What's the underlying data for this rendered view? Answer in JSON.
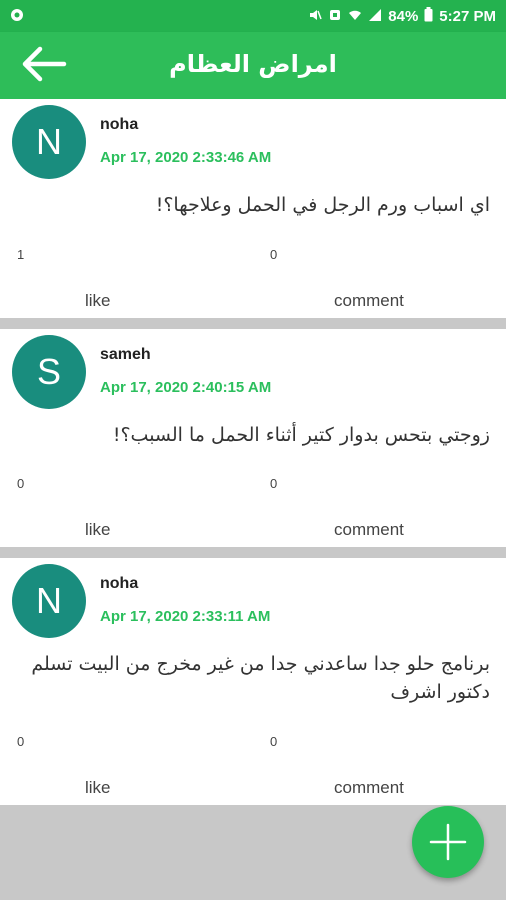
{
  "status_bar": {
    "battery": "84%",
    "time": "5:27 PM"
  },
  "app_bar": {
    "title": "امراض العظام",
    "back_icon": "arrow-left-icon"
  },
  "posts": [
    {
      "avatar_letter": "N",
      "username": "noha",
      "timestamp": "Apr 17, 2020 2:33:46 AM",
      "text": "اي اسباب ورم الرجل في الحمل وعلاجها؟!",
      "like_count": "1",
      "comment_count": "0",
      "like_label": "like",
      "comment_label": "comment"
    },
    {
      "avatar_letter": "S",
      "username": "sameh",
      "timestamp": "Apr 17, 2020 2:40:15 AM",
      "text": "زوجتي بتحس بدوار كتير أثناء الحمل ما السبب؟!",
      "like_count": "0",
      "comment_count": "0",
      "like_label": "like",
      "comment_label": "comment"
    },
    {
      "avatar_letter": "N",
      "username": "noha",
      "timestamp": "Apr 17, 2020 2:33:11 AM",
      "text": "برنامج حلو جدا ساعدني جدا من غير مخرج من البيت تسلم دكتور اشرف",
      "like_count": "0",
      "comment_count": "0",
      "like_label": "like",
      "comment_label": "comment"
    }
  ],
  "fab": {
    "icon": "plus-icon"
  },
  "colors": {
    "status_bar": "#24b24f",
    "app_bar": "#2ebd59",
    "avatar": "#198d7e",
    "timestamp": "#2bbf5d",
    "fab": "#27bf59"
  }
}
